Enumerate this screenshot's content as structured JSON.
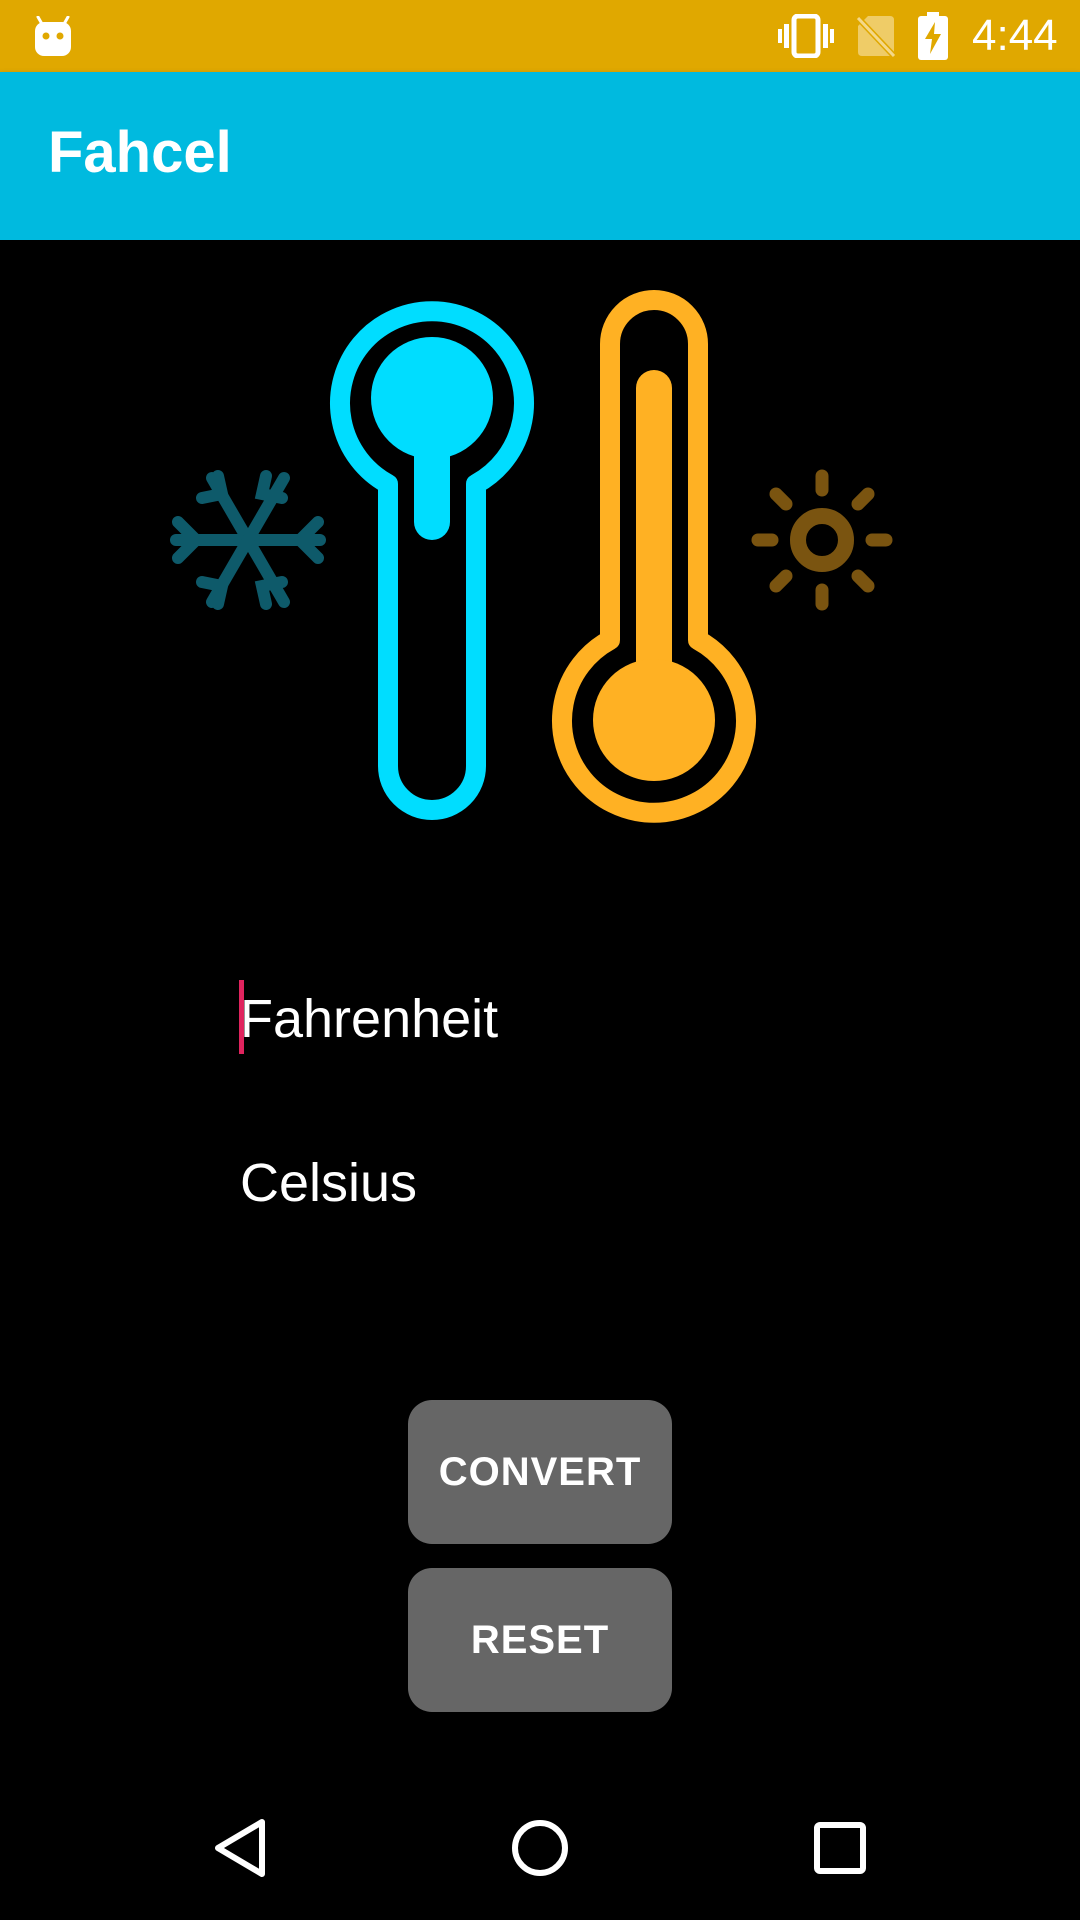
{
  "status_bar": {
    "time": "4:44",
    "background_color": "#E0A800",
    "icons": [
      "android-icon",
      "vibrate-icon",
      "no-sim-icon",
      "battery-charging-icon"
    ]
  },
  "app_bar": {
    "title": "Fahcel",
    "background_color": "#00BADF"
  },
  "illustration": {
    "icons": [
      "snowflake-icon",
      "cold-thermometer-icon",
      "hot-thermometer-icon",
      "sun-icon"
    ],
    "colors": {
      "cold": "#00DDFF",
      "hot": "#FFB123",
      "snowflake": "#0E5A6A",
      "sun": "#7A5410"
    }
  },
  "form": {
    "fahrenheit_placeholder": "Fahrenheit",
    "celsius_placeholder": "Celsius",
    "caret_color": "#E0245E"
  },
  "buttons": {
    "convert_label": "CONVERT",
    "reset_label": "RESET",
    "background_color": "#666666"
  },
  "nav_bar": {
    "icons": [
      "back-icon",
      "home-icon",
      "recents-icon"
    ]
  }
}
